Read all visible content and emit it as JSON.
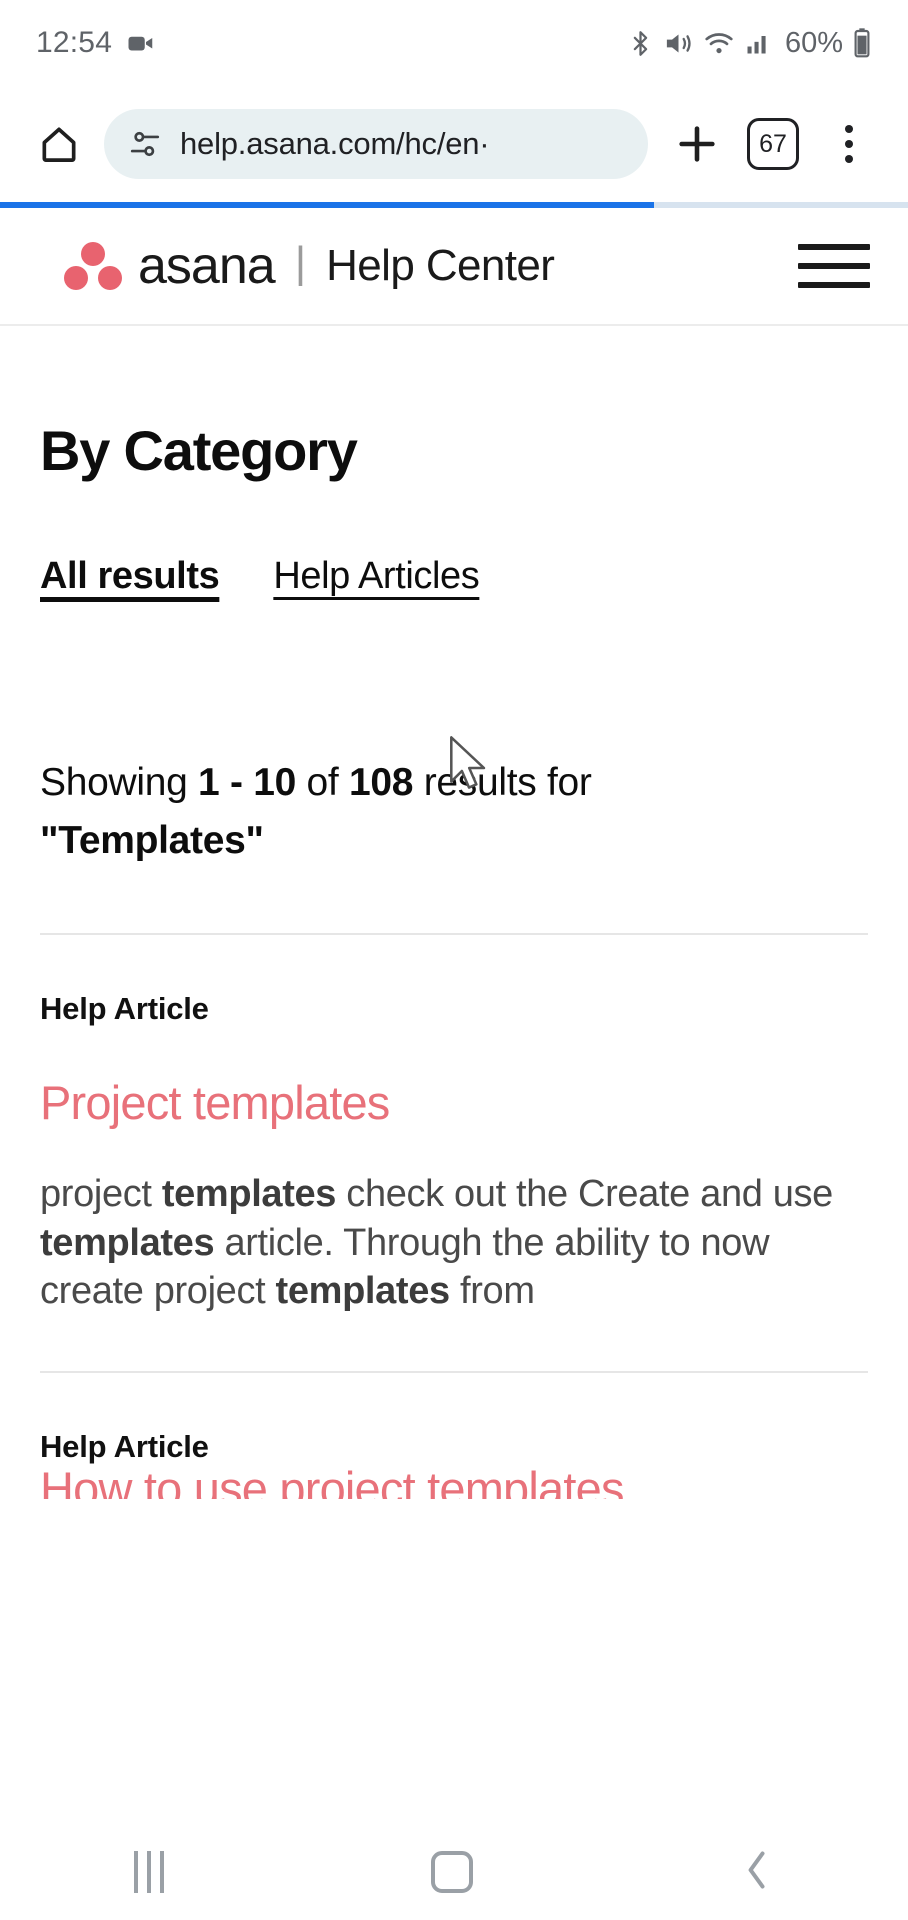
{
  "status_bar": {
    "time": "12:54",
    "battery_percent": "60%",
    "icons": [
      "video-camera-icon",
      "bluetooth-icon",
      "vibrate-icon",
      "wifi-icon",
      "cellular-signal-icon",
      "battery-icon"
    ]
  },
  "browser": {
    "home_icon": "home-icon",
    "site_settings_icon": "site-settings-icon",
    "url": "help.asana.com/hc/en·",
    "new_tab_label": "+",
    "tab_count": "67",
    "menu_icon": "overflow-menu-icon",
    "progress_percent": 72
  },
  "site_header": {
    "brand": "asana",
    "separator": "|",
    "subtitle": "Help Center",
    "menu_icon": "hamburger-menu-icon",
    "logo_color": "#e8636f"
  },
  "main": {
    "page_title": "By Category",
    "tabs": [
      {
        "label": "All results",
        "active": true
      },
      {
        "label": "Help Articles",
        "active": false
      }
    ],
    "showing": {
      "prefix": "Showing ",
      "range": "1 - 10",
      "middle": " of ",
      "total": "108",
      "suffix": " results for ",
      "query": "\"Templates\""
    },
    "results": [
      {
        "kind": "Help Article",
        "title": "Project templates",
        "snippet_parts": [
          {
            "text": "project ",
            "bold": false
          },
          {
            "text": "templates",
            "bold": true
          },
          {
            "text": " check out the Create and use ",
            "bold": false
          },
          {
            "text": "templates",
            "bold": true
          },
          {
            "text": " article. Through the ability to now create project ",
            "bold": false
          },
          {
            "text": "templates",
            "bold": true
          },
          {
            "text": " from",
            "bold": false
          }
        ]
      },
      {
        "kind": "Help Article",
        "title": "How to use project templates",
        "snippet_parts": []
      }
    ]
  },
  "nav_bar": {
    "recents_icon": "recent-apps-icon",
    "home_icon": "home-square-icon",
    "back_icon": "back-chevron-icon"
  },
  "colors": {
    "accent_red": "#e8717a",
    "progress_blue": "#1a73e8",
    "urlbar_bg": "#e8f0f2"
  }
}
